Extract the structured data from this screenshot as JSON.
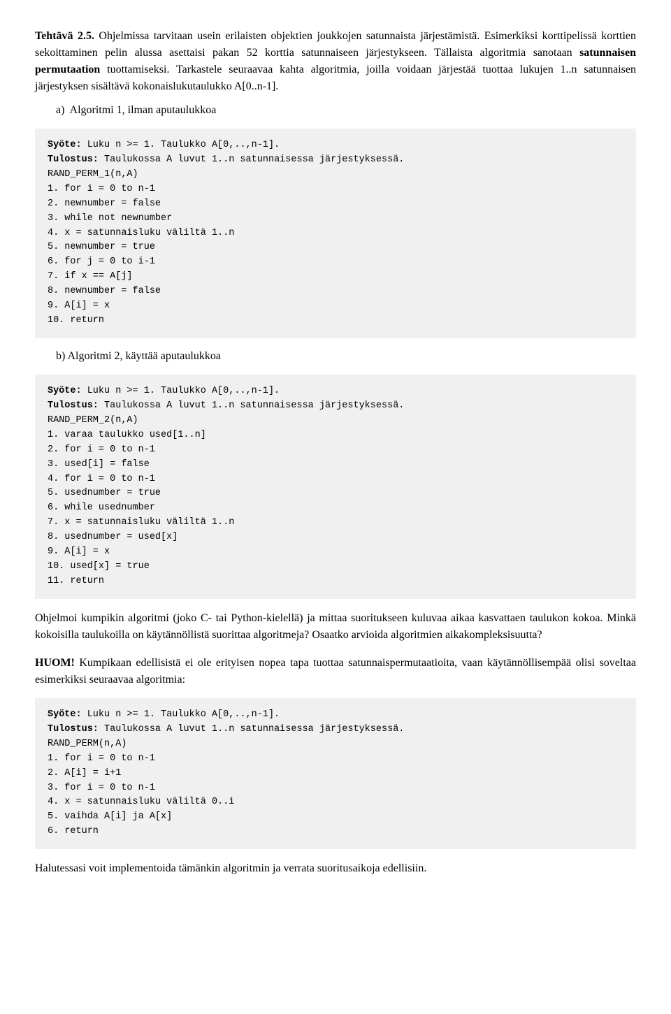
{
  "title": {
    "line1": "Tehtävä 2.5.",
    "line1_rest": " Ohjelmissa tarvitaan usein erilaisten objektien joukkojen satunnaista järjestämistä.",
    "line2": "Esimerkiksi korttipelissä korttien sekoittaminen pelin alussa asettaisi pakan 52 korttia satunnaiseen järjestykseen.",
    "line3_bold": "satunnaisen permutaation",
    "line3_pre": "Tällaista algoritmia sanotaan ",
    "line3_post": " tuottamiseksi.",
    "line4": "Tarkastele seuraavaa kahta algoritmia, joilla voidaan järjestää tuottaa lukujen 1..n satunnaisen järjestyksen sisältävä kokonaislukutaulukko A[0..n-1]."
  },
  "section_a": {
    "label": "a)  Algoritmi 1, ilman aputaulukkoa"
  },
  "code_a": {
    "syote_label": "Syöte:",
    "syote_text": " Luku n >= 1. Taulukko A[0,..,n-1].",
    "tulostus_label": "Tulostus:",
    "tulostus_text": " Taulukossa A luvut 1..n satunnaisessa järjestyksessä.",
    "lines": [
      "RAND_PERM_1(n,A)",
      " 1.  for i = 0 to n-1",
      " 2.      newnumber = false",
      " 3.      while not newnumber",
      " 4.          x = satunnaisluku väliltä 1..n",
      " 5.          newnumber = true",
      " 6.          for j = 0 to i-1",
      " 7.              if x == A[j]",
      " 8.                  newnumber = false",
      " 9.      A[i] = x",
      "10.  return"
    ]
  },
  "section_b": {
    "label": "b)  Algoritmi 2, käyttää aputaulukkoa"
  },
  "code_b": {
    "syote_label": "Syöte:",
    "syote_text": " Luku n >= 1. Taulukko A[0,..,n-1].",
    "tulostus_label": "Tulostus:",
    "tulostus_text": " Taulukossa A luvut 1..n satunnaisessa järjestyksessä.",
    "lines": [
      "RAND_PERM_2(n,A)",
      " 1.  varaa taulukko used[1..n]",
      " 2.  for i = 0 to n-1",
      " 3.      used[i] = false",
      " 4.  for i = 0 to n-1",
      " 5.      usednumber = true",
      " 6.      while usednumber",
      " 7.          x = satunnaisluku väliltä 1..n",
      " 8.          usednumber = used[x]",
      " 9.      A[i] = x",
      "10.      used[x] = true",
      "11.  return"
    ]
  },
  "middle_text": {
    "p1": "Ohjelmoi kumpikin algoritmi (joko C- tai Python-kielellä) ja mittaa suoritukseen kuluvaa aikaa kasvattaen taulukon kokoa. Minkä kokoisilla taulukoilla on käytännöllistä suorittaa algoritmeja? Osaatko arvioida algoritmien aikakompleksisuutta?"
  },
  "huom_text": {
    "prefix": "HUOM!",
    "rest": " Kumpikaan edellisistä ei ole erityisen nopea tapa tuottaa satunnaispermutaatioita, vaan käytännöllisempää olisi soveltaa esimerkiksi seuraavaa algoritmia:"
  },
  "code_c": {
    "syote_label": "Syöte:",
    "syote_text": " Luku n >= 1. Taulukko A[0,..,n-1].",
    "tulostus_label": "Tulostus:",
    "tulostus_text": " Taulukossa A luvut 1..n satunnaisessa järjestyksessä.",
    "lines": [
      "RAND_PERM(n,A)",
      " 1.  for i = 0 to n-1",
      " 2.      A[i] = i+1",
      " 3.  for i = 0 to n-1",
      " 4.      x = satunnaisluku väliltä 0..i",
      " 5.      vaihda A[i] ja A[x]",
      " 6.  return"
    ]
  },
  "bottom_text": {
    "text": "Halutessasi voit implementoida tämänkin algoritmin ja verrata suoritusaikoja edellisiin."
  }
}
